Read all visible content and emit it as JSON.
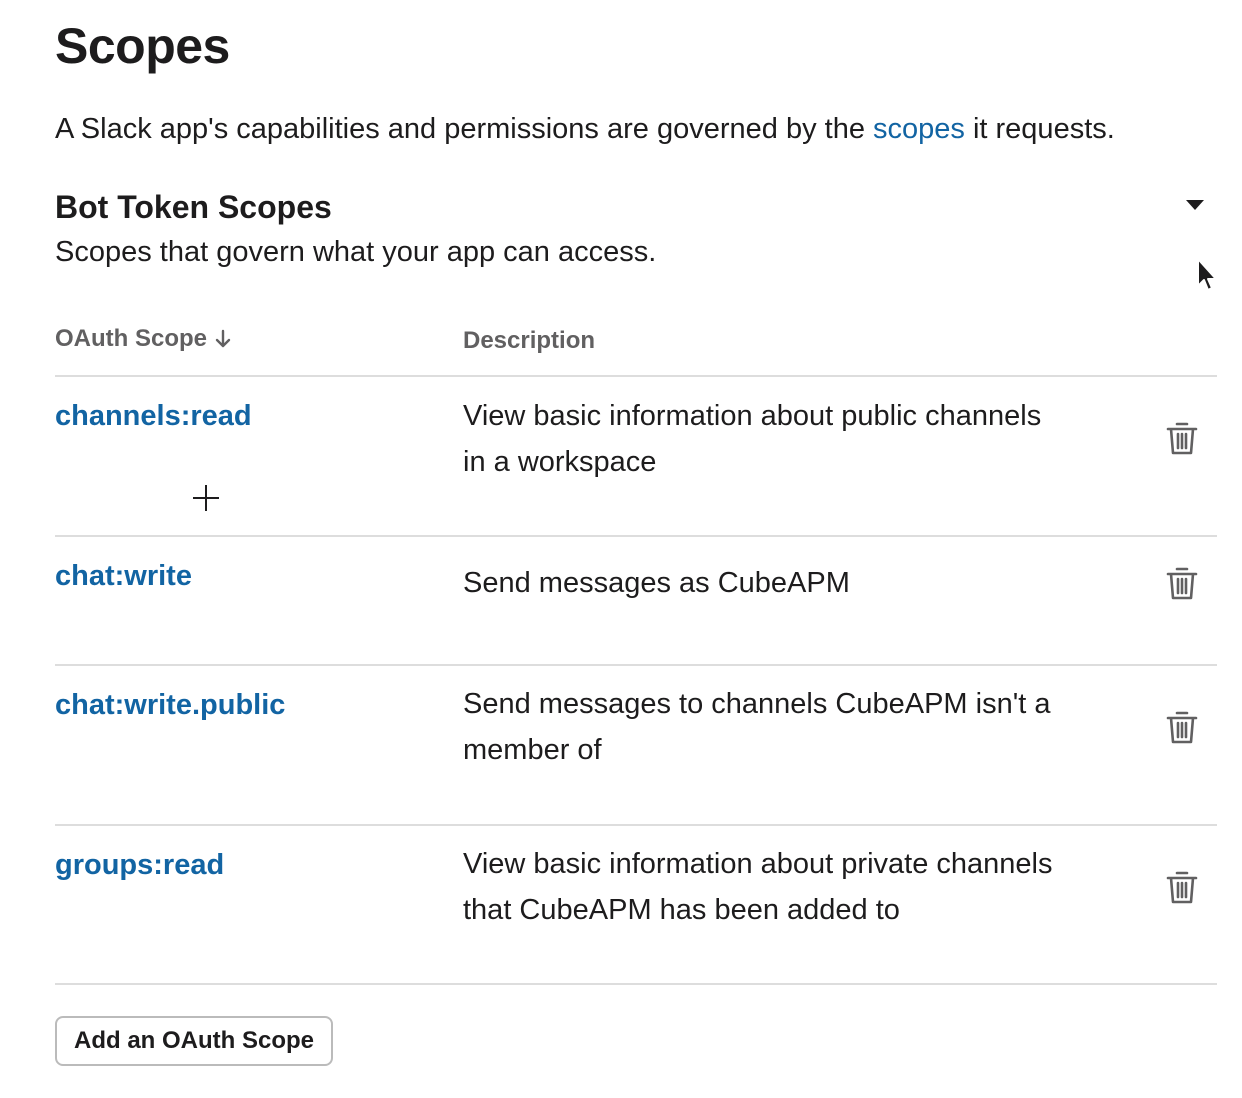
{
  "page": {
    "title": "Scopes",
    "intro_before": "A Slack app's capabilities and permissions are governed by the ",
    "intro_link": "scopes",
    "intro_after": " it requests."
  },
  "section": {
    "title": "Bot Token Scopes",
    "subtitle": "Scopes that govern what your app can access.",
    "toggle_icon": "caret-down-icon"
  },
  "table": {
    "columns": {
      "scope": "OAuth Scope",
      "description": "Description"
    },
    "sort_icon": "arrow-down-icon",
    "rows": [
      {
        "scope": "channels:read",
        "description": "View basic information about public channels in a workspace"
      },
      {
        "scope": "chat:write",
        "description": "Send messages as CubeAPM"
      },
      {
        "scope": "chat:write.public",
        "description": "Send messages to channels CubeAPM isn't a member of"
      },
      {
        "scope": "groups:read",
        "description": "View basic information about private channels that CubeAPM has been added to"
      }
    ],
    "row_action_icon": "trash-icon"
  },
  "actions": {
    "add_scope_label": "Add an OAuth Scope"
  },
  "colors": {
    "link": "#1264a3",
    "text": "#1d1c1d",
    "muted": "#616061",
    "divider": "#dddddd"
  }
}
